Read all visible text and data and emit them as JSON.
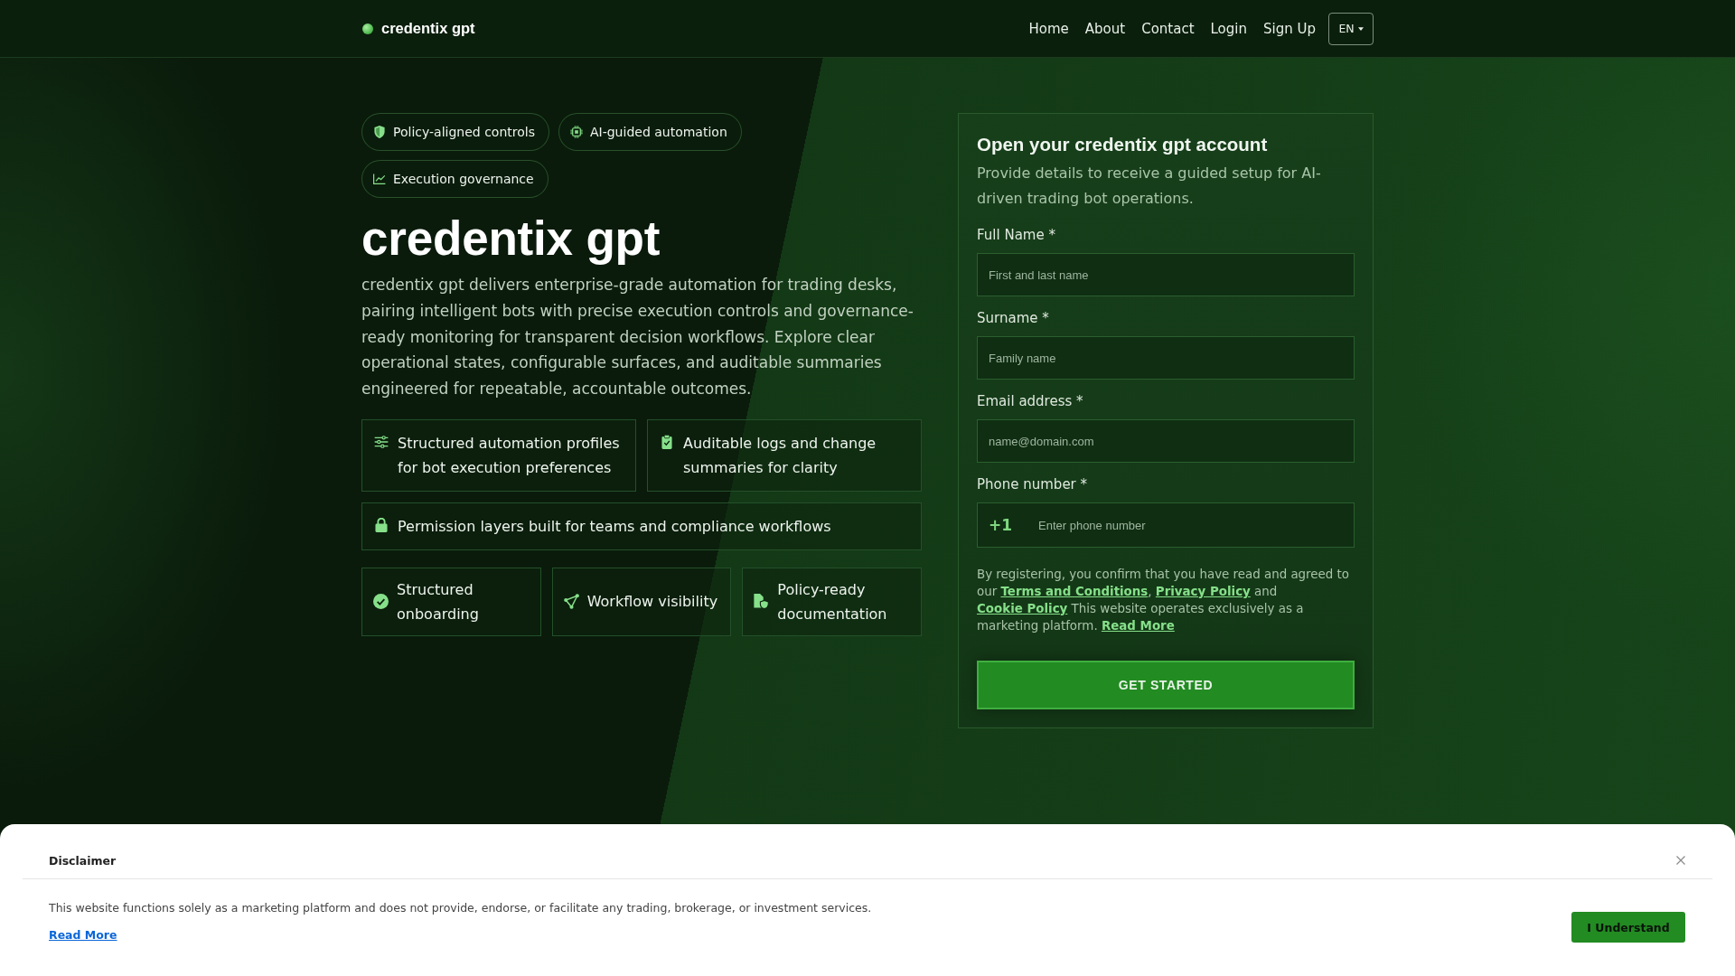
{
  "header": {
    "logo": "credentix gpt",
    "nav": [
      "Home",
      "About",
      "Contact",
      "Login",
      "Sign Up"
    ],
    "language": "EN"
  },
  "hero": {
    "chips": [
      "Policy-aligned controls",
      "AI-guided automation",
      "Execution governance"
    ],
    "title": "credentix gpt",
    "description": "credentix gpt delivers enterprise-grade automation for trading desks, pairing intelligent bots with precise execution controls and governance-ready monitoring for transparent decision workflows. Explore clear operational states, configurable surfaces, and auditable summaries engineered for repeatable, accountable outcomes.",
    "features": [
      "Structured automation profiles for bot execution preferences",
      "Auditable logs and change summaries for clarity",
      "Permission layers built for teams and compliance workflows"
    ],
    "highlights": [
      "Structured onboarding",
      "Workflow visibility",
      "Policy-ready documentation"
    ]
  },
  "form": {
    "title": "Open your credentix gpt account",
    "subtitle": "Provide details to receive a guided setup for AI-driven trading bot operations.",
    "fields": [
      {
        "kind": "text",
        "label": "Full Name *",
        "placeholder": "First and last name"
      },
      {
        "kind": "text",
        "label": "Surname *",
        "placeholder": "Family name"
      },
      {
        "kind": "text",
        "label": "Email address *",
        "placeholder": "name@domain.com"
      },
      {
        "kind": "phone",
        "label": "Phone number *",
        "prefix": "+1",
        "placeholder": "Enter phone number"
      }
    ],
    "consent": [
      {
        "kind": "text",
        "text": "By registering, you confirm that you have read and agreed to our "
      },
      {
        "kind": "link",
        "text": "Terms and Conditions"
      },
      {
        "kind": "text",
        "text": ", "
      },
      {
        "kind": "link",
        "text": "Privacy Policy"
      },
      {
        "kind": "text",
        "text": " and "
      },
      {
        "kind": "link",
        "text": "Cookie Policy"
      },
      {
        "kind": "text",
        "text": " This website operates exclusively as a marketing platform. "
      },
      {
        "kind": "link",
        "text": "Read More"
      }
    ],
    "submit": "GET STARTED"
  },
  "disclaimer": {
    "title": "Disclaimer",
    "text": "This website functions solely as a marketing platform and does not provide, endorse, or facilitate any trading, brokerage, or investment services.",
    "link": "Read More",
    "button": "I Understand"
  }
}
